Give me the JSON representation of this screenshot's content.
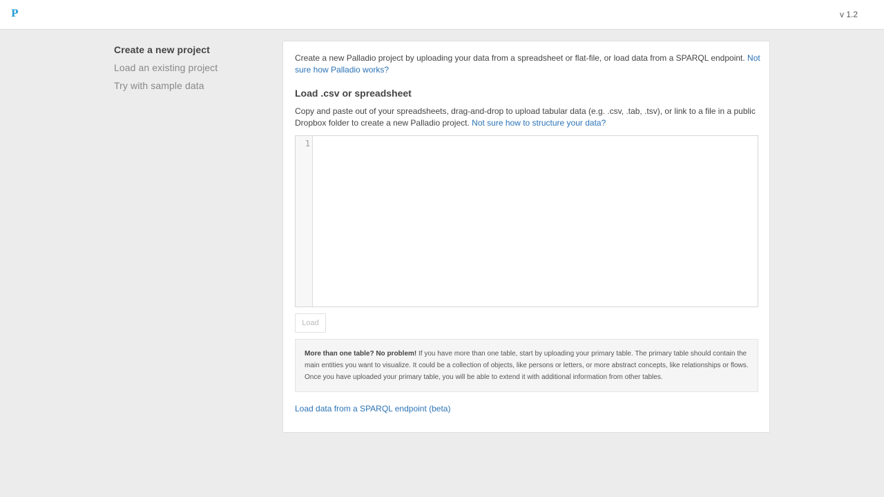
{
  "header": {
    "logo": "P",
    "version": "v 1.2"
  },
  "sidebar": {
    "items": [
      {
        "label": "Create a new project"
      },
      {
        "label": "Load an existing project"
      },
      {
        "label": "Try with sample data"
      }
    ]
  },
  "main": {
    "intro_text": "Create a new Palladio project by uploading your data from a spreadsheet or flat-file, or load data from a SPARQL endpoint. ",
    "intro_link": "Not sure how Palladio works?",
    "section_title": "Load .csv or spreadsheet",
    "section_text": "Copy and paste out of your spreadsheets, drag-and-drop to upload tabular data (e.g. .csv, .tab, .tsv), or link to a file in a public Dropbox folder to create a new Palladio project. ",
    "section_link": "Not sure how to structure your data?",
    "editor": {
      "line_number": "1",
      "value": ""
    },
    "load_button": "Load",
    "info": {
      "bold": "More than one table? No problem!",
      "text": " If you have more than one table, start by uploading your primary table. The primary table should contain the main entities you want to visualize. It could be a collection of objects, like persons or letters, or more abstract concepts, like relationships or flows. Once you have uploaded your primary table, you will be able to extend it with additional information from other tables."
    },
    "sparql_link": "Load data from a SPARQL endpoint (beta)"
  },
  "colors": {
    "accent": "#2a9fd6",
    "link": "#2b73b6",
    "background": "#ececec"
  }
}
